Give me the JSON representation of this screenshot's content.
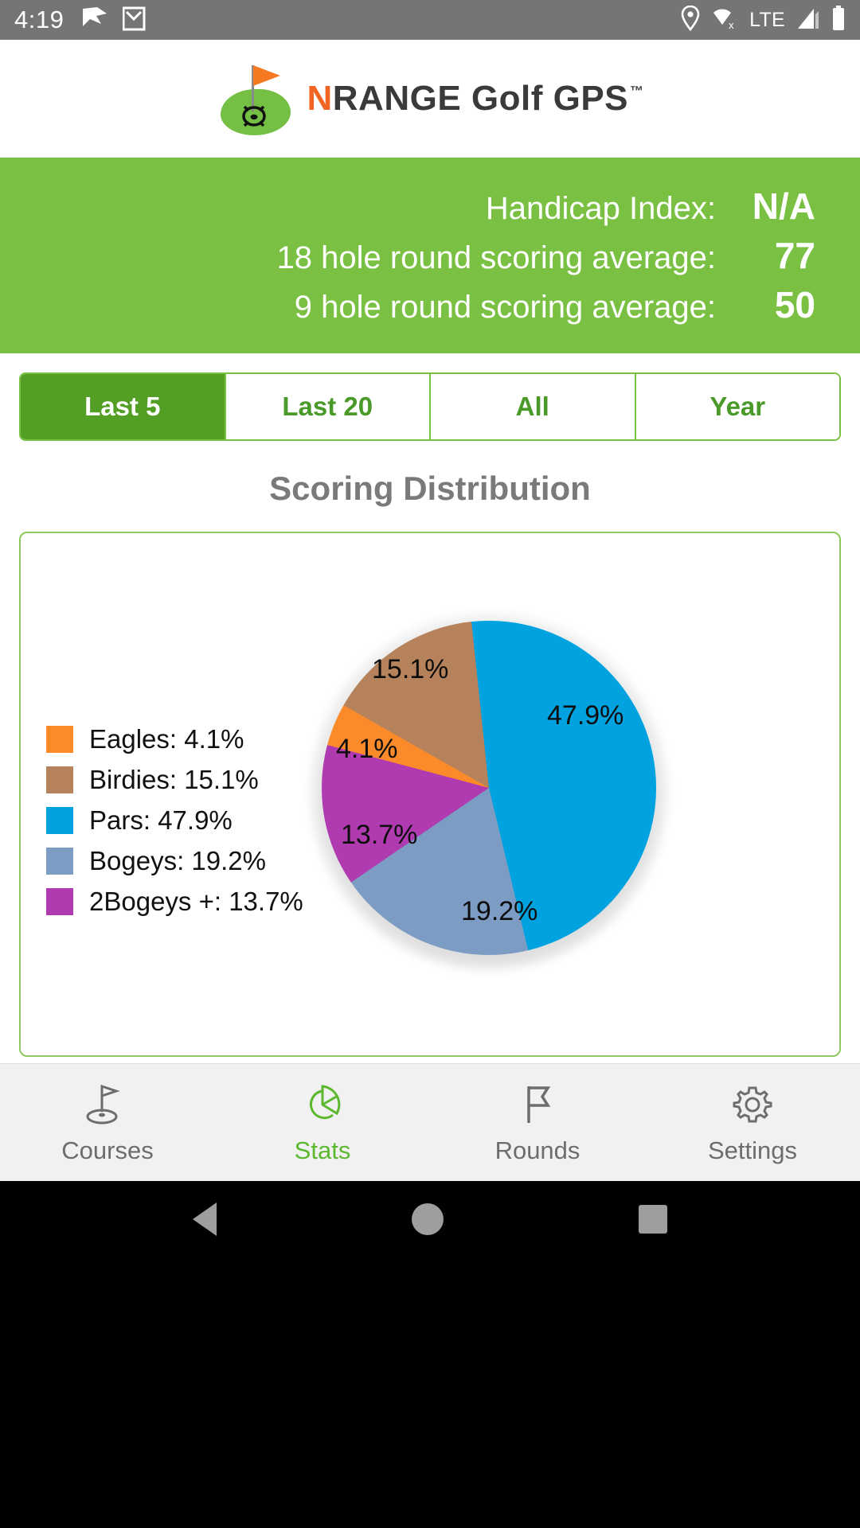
{
  "status_bar": {
    "time": "4:19",
    "left_icons": [
      "bird-notification-icon",
      "gmail-icon"
    ],
    "right_icons": [
      "location-pin-icon",
      "wifi-off-icon",
      "signal-icon",
      "battery-icon"
    ],
    "network_label": "LTE"
  },
  "app_header": {
    "brand_prefix": "N",
    "brand_rest": "RANGE Golf GPS",
    "trademark": "™",
    "brand_accent_color": "#f06522",
    "brand_text_color": "#3a3a3a",
    "logo_icon": "golf-green-flag-logo"
  },
  "summary": {
    "background_color": "#7ac143",
    "rows": [
      {
        "label": "Handicap Index:",
        "value": "N/A"
      },
      {
        "label": "18 hole round scoring average:",
        "value": "77"
      },
      {
        "label": "9 hole round scoring average:",
        "value": "50"
      }
    ]
  },
  "filter_tabs": {
    "active_index": 0,
    "active_color": "#539e25",
    "items": [
      {
        "label": "Last 5"
      },
      {
        "label": "Last 20"
      },
      {
        "label": "All"
      },
      {
        "label": "Year"
      }
    ]
  },
  "chart_data": {
    "type": "pie",
    "title": "Scoring Distribution",
    "categories": [
      "Eagles",
      "Birdies",
      "Pars",
      "Bogeys",
      "2Bogeys +"
    ],
    "values": [
      4.1,
      15.1,
      47.9,
      19.2,
      13.7
    ],
    "value_labels": [
      "4.1%",
      "15.1%",
      "47.9%",
      "19.2%",
      "13.7%"
    ],
    "colors": [
      "#fb8b2a",
      "#b5825b",
      "#00a3e0",
      "#7d9cc4",
      "#b03bb0"
    ],
    "legend": [
      {
        "label": "Eagles: 4.1%",
        "color": "#fb8b2a"
      },
      {
        "label": "Birdies: 15.1%",
        "color": "#b5825b"
      },
      {
        "label": "Pars: 47.9%",
        "color": "#00a3e0"
      },
      {
        "label": "Bogeys: 19.2%",
        "color": "#7d9cc4"
      },
      {
        "label": "2Bogeys +: 13.7%",
        "color": "#b03bb0"
      }
    ],
    "legend_position": "left",
    "grid": false,
    "xlabel": "",
    "ylabel": ""
  },
  "pager": {
    "total": 5,
    "active_index": 0,
    "active_color": "#5cb82e",
    "inactive_color": "#c9c9c9"
  },
  "bottom_nav": {
    "active_index": 1,
    "active_color": "#5cb82e",
    "items": [
      {
        "label": "Courses",
        "icon": "golf-green-flag-icon"
      },
      {
        "label": "Stats",
        "icon": "pie-chart-icon"
      },
      {
        "label": "Rounds",
        "icon": "flag-icon"
      },
      {
        "label": "Settings",
        "icon": "gear-icon"
      }
    ]
  },
  "android_nav": {
    "items": [
      {
        "label": "Back",
        "icon": "triangle-back-icon"
      },
      {
        "label": "Home",
        "icon": "circle-home-icon"
      },
      {
        "label": "Recents",
        "icon": "square-recents-icon"
      }
    ]
  }
}
